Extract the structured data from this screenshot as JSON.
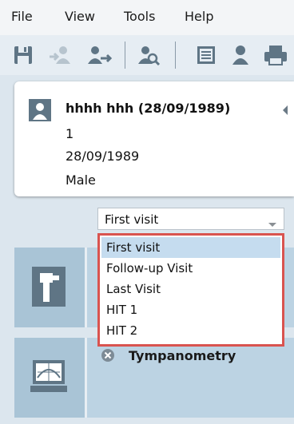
{
  "menubar": {
    "items": [
      "File",
      "View",
      "Tools",
      "Help"
    ]
  },
  "toolbar": {
    "icons": [
      "save-icon",
      "transfer-user-icon",
      "export-user-icon",
      "search-user-icon",
      "form-icon",
      "user-icon",
      "print-icon"
    ]
  },
  "patient": {
    "name_line": "hhhh hhh (28/09/1989)",
    "id": "1",
    "dob": "28/09/1989",
    "sex": "Male"
  },
  "visit_select": {
    "value": "First visit",
    "options": [
      "First visit",
      "Follow-up Visit",
      "Last Visit",
      "HIT 1",
      "HIT 2"
    ],
    "selected_index": 0
  },
  "modules": [
    {
      "title": "",
      "icon": "otoscope-icon"
    },
    {
      "title": "Tympanometry",
      "icon": "tympanometry-monitor-icon"
    }
  ],
  "colors": {
    "highlight_border": "#d9534f",
    "selected_option": "#c5dcef",
    "tile_bg": "#bcd3e3"
  }
}
